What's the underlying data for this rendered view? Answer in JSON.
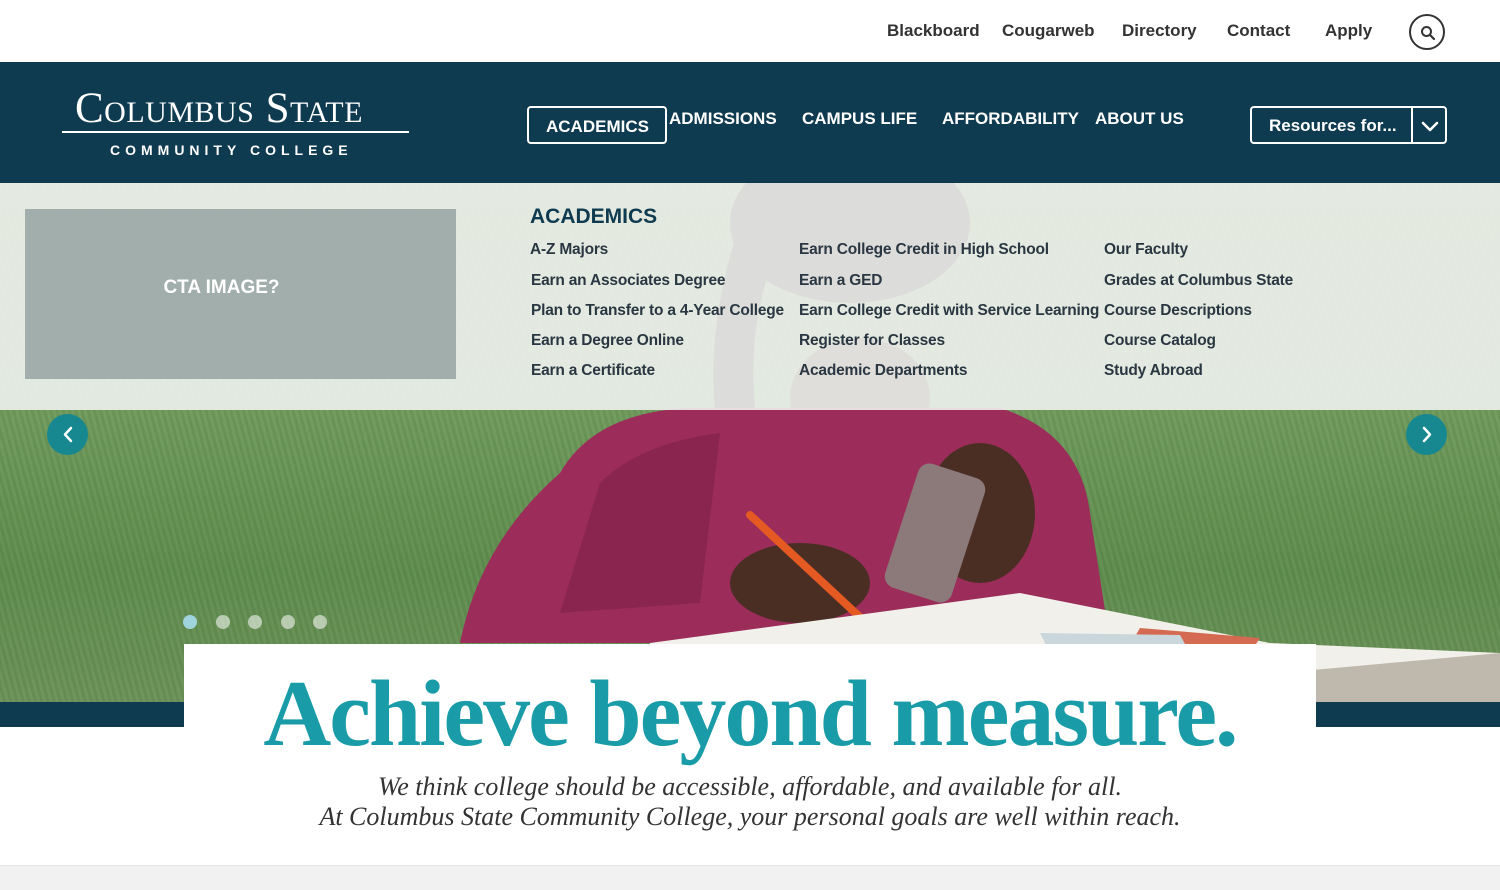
{
  "utility_nav": {
    "links": [
      "Blackboard",
      "Cougarweb",
      "Directory",
      "Contact",
      "Apply"
    ]
  },
  "logo": {
    "title": "Columbus State",
    "subtitle": "COMMUNITY COLLEGE"
  },
  "main_nav": {
    "items": [
      "ACADEMICS",
      "ADMISSIONS",
      "CAMPUS LIFE",
      "AFFORDABILITY",
      "ABOUT US"
    ],
    "active": "ACADEMICS",
    "resources_label": "Resources for..."
  },
  "mega_menu": {
    "cta_label": "CTA IMAGE?",
    "title": "ACADEMICS",
    "columns": [
      [
        "A-Z Majors",
        "Earn an Associates Degree",
        "Plan to Transfer to a 4-Year College",
        "Earn a Degree Online",
        "Earn a Certificate"
      ],
      [
        "Earn College Credit in High School",
        "Earn a GED",
        "Earn College Credit with Service Learning",
        "Register for Classes",
        "Academic Departments"
      ],
      [
        "Our Faculty",
        "Grades at Columbus State",
        "Course Descriptions",
        "Course Catalog",
        "Study Abroad"
      ]
    ]
  },
  "carousel": {
    "slide_count": 5,
    "active_slide": 1
  },
  "hero_text": {
    "headline": "Achieve beyond  measure.",
    "line1": "We think college should be accessible, affordable, and available for all.",
    "line2": "At Columbus State Community College, your personal goals are well within reach."
  },
  "colors": {
    "navy": "#0f3b51",
    "teal": "#1a9ca8",
    "arrow_teal": "#17888f"
  },
  "icons": [
    "search-icon",
    "chevron-down-icon",
    "chevron-left-icon",
    "chevron-right-icon"
  ]
}
